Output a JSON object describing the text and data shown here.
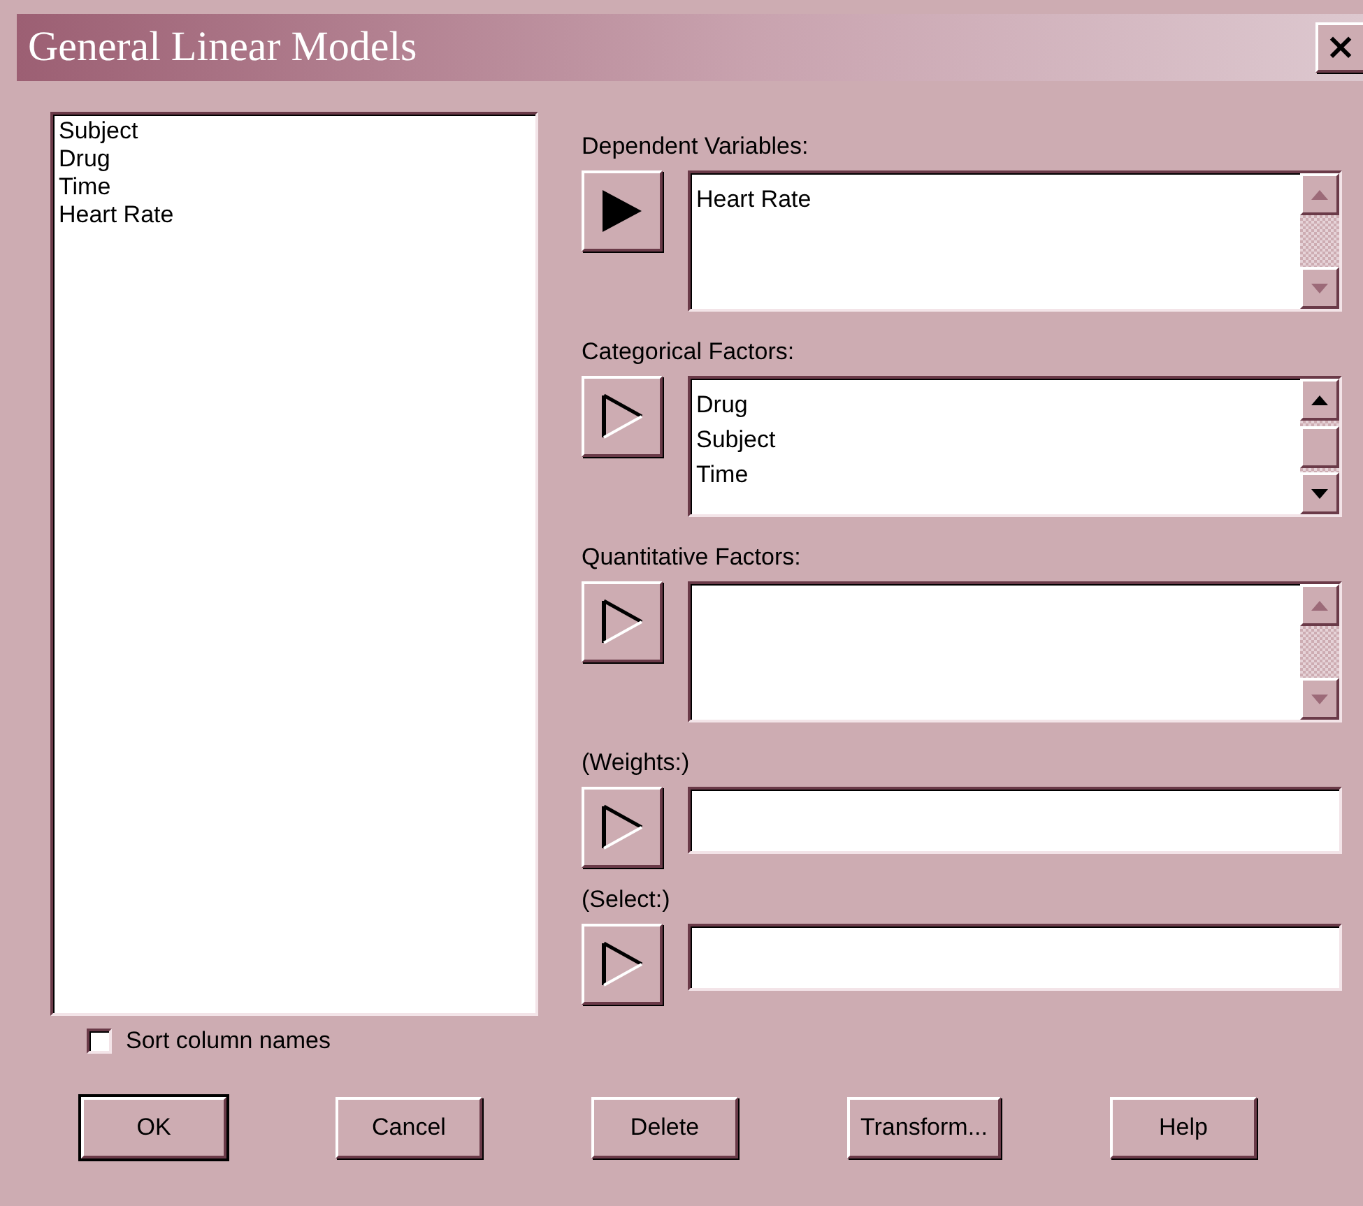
{
  "window": {
    "title": "General Linear Models",
    "close": "×"
  },
  "variables": [
    "Subject",
    "Drug",
    "Time",
    "Heart Rate"
  ],
  "sort_column_names": {
    "label": "Sort column names",
    "checked": false
  },
  "inputs": [
    {
      "label": "Dependent Variables:",
      "kind": "list",
      "arrow_filled": true,
      "scroll_enabled": false,
      "items": [
        "Heart Rate"
      ]
    },
    {
      "label": "Categorical Factors:",
      "kind": "list",
      "arrow_filled": false,
      "scroll_enabled": true,
      "items": [
        "Drug",
        "Subject",
        "Time"
      ]
    },
    {
      "label": "Quantitative Factors:",
      "kind": "list",
      "arrow_filled": false,
      "scroll_enabled": false
    },
    {
      "label": "(Weights:)",
      "kind": "field",
      "arrow_filled": false
    },
    {
      "label": "(Select:)",
      "kind": "field",
      "arrow_filled": false
    }
  ],
  "buttons": [
    {
      "label": "OK",
      "default": true
    },
    {
      "label": "Cancel",
      "default": false
    },
    {
      "label": "Delete",
      "default": false
    },
    {
      "label": "Transform...",
      "default": false
    },
    {
      "label": "Help",
      "default": false
    }
  ]
}
